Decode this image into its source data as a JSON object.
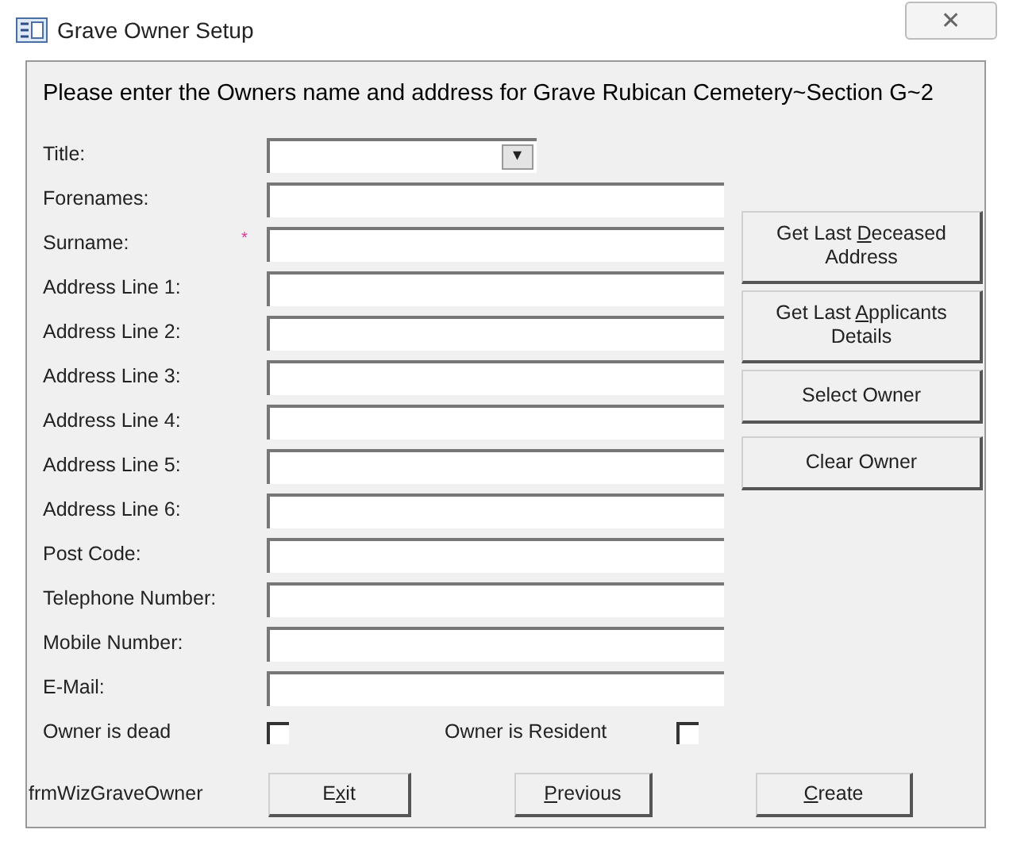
{
  "window": {
    "title": "Grave Owner Setup",
    "close": "✕"
  },
  "heading": "Please enter the Owners name and address for Grave Rubican Cemetery~Section G~2",
  "fields": [
    {
      "kind": "combo",
      "label": "Title:",
      "required": false,
      "arrow": "▾"
    },
    {
      "kind": "text",
      "label": "Forenames:",
      "required": false
    },
    {
      "kind": "text",
      "label": "Surname:",
      "required": true
    },
    {
      "kind": "text",
      "label": "Address Line 1:",
      "required": false
    },
    {
      "kind": "text",
      "label": "Address Line 2:",
      "required": false
    },
    {
      "kind": "text",
      "label": "Address Line 3:",
      "required": false
    },
    {
      "kind": "text",
      "label": "Address Line 4:",
      "required": false
    },
    {
      "kind": "text",
      "label": "Address Line 5:",
      "required": false
    },
    {
      "kind": "text",
      "label": "Address Line 6:",
      "required": false
    },
    {
      "kind": "text",
      "label": "Post Code:",
      "required": false
    },
    {
      "kind": "text",
      "label": "Telephone Number:",
      "required": false
    },
    {
      "kind": "text",
      "label": "Mobile Number:",
      "required": false
    },
    {
      "kind": "text",
      "label": "E-Mail:",
      "required": false
    }
  ],
  "required_mark": "*",
  "side_buttons": [
    {
      "before": "Get Last ",
      "key": "D",
      "after": "eceased Address"
    },
    {
      "before": "Get Last ",
      "key": "A",
      "after": "pplicants Details"
    },
    {
      "before": "Select Owner"
    },
    {
      "before": "Clear Owner"
    }
  ],
  "checkboxes": [
    {
      "label": "Owner is dead",
      "checked": false
    },
    {
      "label": "Owner is Resident",
      "checked": false
    }
  ],
  "form_name": "frmWizGraveOwner",
  "bottom_buttons": [
    {
      "before": "E",
      "key": "x",
      "after": "it"
    },
    {
      "key": "P",
      "after": "revious"
    },
    {
      "key": "C",
      "after": "reate"
    }
  ]
}
